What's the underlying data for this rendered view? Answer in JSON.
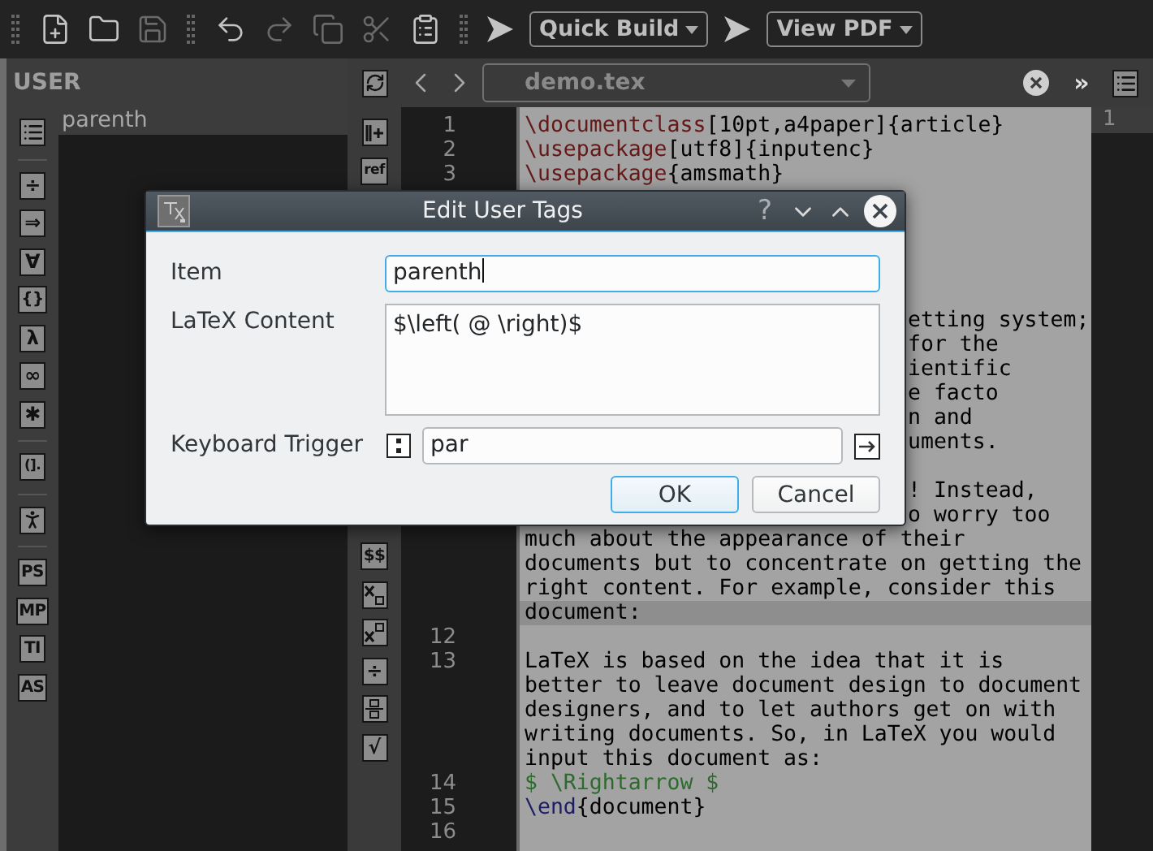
{
  "toolbar": [
    {
      "kind": "grip"
    },
    {
      "kind": "new",
      "disabled": false
    },
    {
      "kind": "open",
      "disabled": false
    },
    {
      "kind": "save",
      "disabled": true
    },
    {
      "kind": "grip"
    },
    {
      "kind": "undo",
      "disabled": false
    },
    {
      "kind": "redo",
      "disabled": true
    },
    {
      "kind": "copy",
      "disabled": true
    },
    {
      "kind": "cut",
      "disabled": true
    },
    {
      "kind": "paste",
      "disabled": false
    },
    {
      "kind": "grip"
    },
    {
      "kind": "run"
    },
    {
      "kind": "dropdown",
      "label": "Quick Build"
    },
    {
      "kind": "run"
    },
    {
      "kind": "dropdown",
      "label": "View PDF"
    }
  ],
  "panel": {
    "title": "USER",
    "items": [
      {
        "label": "parenth"
      }
    ],
    "tools": [
      {
        "kind": "list"
      },
      {
        "kind": "separator"
      },
      {
        "kind": "glyph",
        "label": "÷"
      },
      {
        "kind": "glyph",
        "label": "⇒"
      },
      {
        "kind": "glyph",
        "label": "∀"
      },
      {
        "kind": "glyph",
        "label": "{}"
      },
      {
        "kind": "glyph",
        "label": "λ"
      },
      {
        "kind": "glyph",
        "label": "∞"
      },
      {
        "kind": "glyph",
        "label": "✱"
      },
      {
        "kind": "separator"
      },
      {
        "kind": "glyph",
        "label": "(]."
      },
      {
        "kind": "separator"
      },
      {
        "kind": "figure"
      },
      {
        "kind": "separator"
      },
      {
        "kind": "glyph",
        "label": "PS"
      },
      {
        "kind": "glyph",
        "label": "MP"
      },
      {
        "kind": "glyph",
        "label": "TI"
      },
      {
        "kind": "glyph",
        "label": "AS"
      }
    ]
  },
  "symbols": {
    "top": [
      {
        "kind": "insert"
      },
      {
        "kind": "glyph",
        "label": "ref"
      }
    ],
    "bottom": [
      {
        "kind": "glyph",
        "label": "$$"
      },
      {
        "kind": "subscript"
      },
      {
        "kind": "superscript"
      },
      {
        "kind": "glyph",
        "label": "÷"
      },
      {
        "kind": "fraction"
      },
      {
        "kind": "glyph",
        "label": "√"
      }
    ]
  },
  "editor": {
    "file": "demo.tex",
    "more": "»",
    "top_rows": [
      {
        "number": "1",
        "current": false,
        "tokens": [
          {
            "kind": "command",
            "text": "\\documentclass"
          },
          {
            "kind": "plain",
            "text": "[10pt,a4paper]{article}"
          }
        ]
      },
      {
        "number": "2",
        "current": false,
        "tokens": [
          {
            "kind": "command",
            "text": "\\usepackage"
          },
          {
            "kind": "plain",
            "text": "[utf8]{inputenc}"
          }
        ]
      },
      {
        "number": "3",
        "current": false,
        "tokens": [
          {
            "kind": "command",
            "text": "\\usepackage"
          },
          {
            "kind": "plain",
            "text": "{amsmath}"
          }
        ]
      }
    ],
    "rows": [
      {
        "kind": "tail",
        "current": false,
        "tokens": [
          {
            "kind": "plain",
            "text": "etting system;"
          }
        ]
      },
      {
        "kind": "tail",
        "current": false,
        "tokens": [
          {
            "kind": "plain",
            "text": "for the"
          }
        ]
      },
      {
        "kind": "tail",
        "current": false,
        "tokens": [
          {
            "kind": "plain",
            "text": "ientific"
          }
        ]
      },
      {
        "kind": "tail",
        "current": false,
        "tokens": [
          {
            "kind": "plain",
            "text": "e facto"
          }
        ]
      },
      {
        "kind": "tail",
        "current": false,
        "tokens": [
          {
            "kind": "plain",
            "text": "n and"
          }
        ]
      },
      {
        "kind": "tail",
        "current": false,
        "tokens": [
          {
            "kind": "plain",
            "text": "uments."
          }
        ]
      },
      {
        "kind": "full",
        "current": false
      },
      {
        "kind": "tail",
        "current": false,
        "tokens": [
          {
            "kind": "plain",
            "text": "! Instead,"
          }
        ]
      },
      {
        "kind": "tail",
        "current": false,
        "tokens": [
          {
            "kind": "plain",
            "text": "o worry too"
          }
        ]
      },
      {
        "kind": "full",
        "current": false,
        "tokens": [
          {
            "kind": "plain",
            "text": "much about the appearance of their"
          }
        ]
      },
      {
        "kind": "full",
        "current": false,
        "tokens": [
          {
            "kind": "plain",
            "text": "documents but to concentrate on getting the"
          }
        ]
      },
      {
        "kind": "full",
        "current": false,
        "tokens": [
          {
            "kind": "plain",
            "text": "right content. For example, consider this"
          }
        ]
      },
      {
        "kind": "full",
        "current": true,
        "tokens": [
          {
            "kind": "plain",
            "text": "document:"
          }
        ]
      },
      {
        "kind": "full",
        "number": "12",
        "current": false
      },
      {
        "kind": "full",
        "number": "13",
        "current": false,
        "tokens": [
          {
            "kind": "plain",
            "text": "LaTeX is based on the idea that it is"
          }
        ]
      },
      {
        "kind": "full",
        "current": false,
        "tokens": [
          {
            "kind": "plain",
            "text": "better to leave document design to document"
          }
        ]
      },
      {
        "kind": "full",
        "current": false,
        "tokens": [
          {
            "kind": "plain",
            "text": "designers, and to let authors get on with"
          }
        ]
      },
      {
        "kind": "full",
        "current": false,
        "tokens": [
          {
            "kind": "plain",
            "text": "writing documents. So, in LaTeX you would"
          }
        ]
      },
      {
        "kind": "full",
        "current": false,
        "tokens": [
          {
            "kind": "plain",
            "text": "input this document as:"
          }
        ]
      },
      {
        "kind": "full",
        "number": "14",
        "current": false,
        "tokens": [
          {
            "kind": "math",
            "text": "$ \\Rightarrow $"
          }
        ]
      },
      {
        "kind": "full",
        "number": "15",
        "current": false,
        "tokens": [
          {
            "kind": "environment",
            "text": "\\end"
          },
          {
            "kind": "plain",
            "text": "{document}"
          }
        ]
      },
      {
        "kind": "full",
        "number": "16",
        "current": false
      }
    ]
  },
  "side_view": {
    "label": "1"
  },
  "dialog": {
    "title": "Edit User Tags",
    "help": "?",
    "fields": [
      {
        "kind": "line",
        "label": "Item",
        "value": "parenth",
        "focused": true
      },
      {
        "kind": "text",
        "label": "LaTeX Content",
        "value": "$\\left( @ \\right)$",
        "focused": false
      },
      {
        "kind": "trigger",
        "label": "Keyboard Trigger",
        "value": "par",
        "focused": false
      }
    ],
    "buttons": [
      {
        "label": "OK",
        "default": true
      },
      {
        "label": "Cancel",
        "default": false
      }
    ]
  }
}
